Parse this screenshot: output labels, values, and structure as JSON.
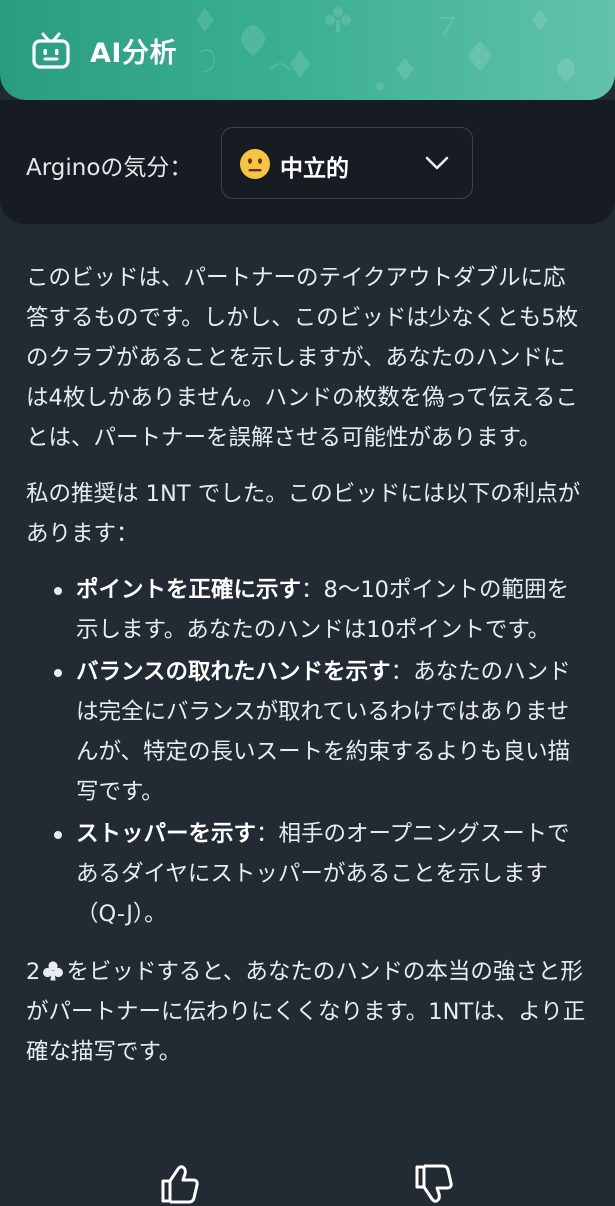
{
  "header": {
    "title": "AI分析",
    "icon": "robot-icon"
  },
  "mood": {
    "label": "Arginoの気分：",
    "selected_value": "中立的",
    "emoji_icon": "neutral-face-icon"
  },
  "content": {
    "paragraph1": "このビッドは、パートナーのテイクアウトダブルに応答するものです。しかし、このビッドは少なくとも5枚のクラブがあることを示しますが、あなたのハンドには4枚しかありません。ハンドの枚数を偽って伝えることは、パートナーを誤解させる可能性があります。",
    "paragraph2": "私の推奨は 1NT でした。このビッドには以下の利点があります：",
    "benefits": [
      {
        "title": "ポイントを正確に示す",
        "text": "：8〜10ポイントの範囲を示します。あなたのハンドは10ポイントです。"
      },
      {
        "title": "バランスの取れたハンドを示す",
        "text": "：あなたのハンドは完全にバランスが取れているわけではありませんが、特定の長いスートを約束するよりも良い描写です。"
      },
      {
        "title": "ストッパーを示す",
        "text": "：相手のオープニングスートであるダイヤにストッパーがあることを示します（Q-J）。"
      }
    ],
    "paragraph3_prefix": "2",
    "paragraph3_suit_icon": "club-suit-icon",
    "paragraph3_rest": "をビッドすると、あなたのハンドの本当の強さと形がパートナーに伝わりにくくなります。1NTは、より正確な描写です。"
  },
  "feedback": {
    "like_icon": "thumbs-up-icon",
    "dislike_icon": "thumbs-down-icon"
  },
  "colors": {
    "header_start": "#2a9c82",
    "header_end": "#62c2ad",
    "background": "#222a33",
    "panel": "#171c22",
    "text": "#e9ecef"
  }
}
